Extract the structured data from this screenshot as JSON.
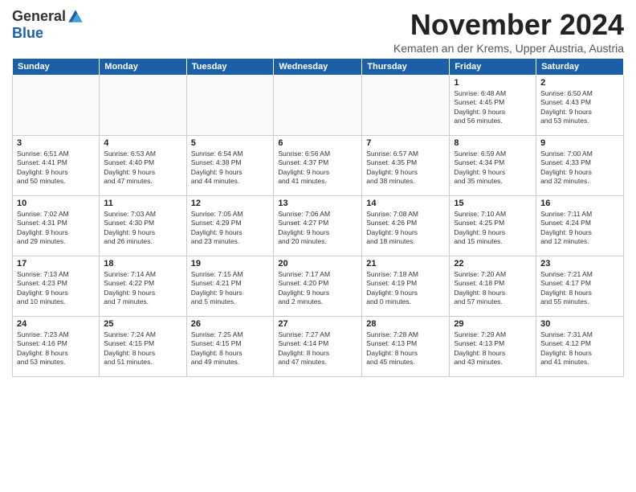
{
  "logo": {
    "general": "General",
    "blue": "Blue"
  },
  "title": "November 2024",
  "location": "Kematen an der Krems, Upper Austria, Austria",
  "headers": [
    "Sunday",
    "Monday",
    "Tuesday",
    "Wednesday",
    "Thursday",
    "Friday",
    "Saturday"
  ],
  "weeks": [
    [
      {
        "day": "",
        "info": ""
      },
      {
        "day": "",
        "info": ""
      },
      {
        "day": "",
        "info": ""
      },
      {
        "day": "",
        "info": ""
      },
      {
        "day": "",
        "info": ""
      },
      {
        "day": "1",
        "info": "Sunrise: 6:48 AM\nSunset: 4:45 PM\nDaylight: 9 hours\nand 56 minutes."
      },
      {
        "day": "2",
        "info": "Sunrise: 6:50 AM\nSunset: 4:43 PM\nDaylight: 9 hours\nand 53 minutes."
      }
    ],
    [
      {
        "day": "3",
        "info": "Sunrise: 6:51 AM\nSunset: 4:41 PM\nDaylight: 9 hours\nand 50 minutes."
      },
      {
        "day": "4",
        "info": "Sunrise: 6:53 AM\nSunset: 4:40 PM\nDaylight: 9 hours\nand 47 minutes."
      },
      {
        "day": "5",
        "info": "Sunrise: 6:54 AM\nSunset: 4:38 PM\nDaylight: 9 hours\nand 44 minutes."
      },
      {
        "day": "6",
        "info": "Sunrise: 6:56 AM\nSunset: 4:37 PM\nDaylight: 9 hours\nand 41 minutes."
      },
      {
        "day": "7",
        "info": "Sunrise: 6:57 AM\nSunset: 4:35 PM\nDaylight: 9 hours\nand 38 minutes."
      },
      {
        "day": "8",
        "info": "Sunrise: 6:59 AM\nSunset: 4:34 PM\nDaylight: 9 hours\nand 35 minutes."
      },
      {
        "day": "9",
        "info": "Sunrise: 7:00 AM\nSunset: 4:33 PM\nDaylight: 9 hours\nand 32 minutes."
      }
    ],
    [
      {
        "day": "10",
        "info": "Sunrise: 7:02 AM\nSunset: 4:31 PM\nDaylight: 9 hours\nand 29 minutes."
      },
      {
        "day": "11",
        "info": "Sunrise: 7:03 AM\nSunset: 4:30 PM\nDaylight: 9 hours\nand 26 minutes."
      },
      {
        "day": "12",
        "info": "Sunrise: 7:05 AM\nSunset: 4:29 PM\nDaylight: 9 hours\nand 23 minutes."
      },
      {
        "day": "13",
        "info": "Sunrise: 7:06 AM\nSunset: 4:27 PM\nDaylight: 9 hours\nand 20 minutes."
      },
      {
        "day": "14",
        "info": "Sunrise: 7:08 AM\nSunset: 4:26 PM\nDaylight: 9 hours\nand 18 minutes."
      },
      {
        "day": "15",
        "info": "Sunrise: 7:10 AM\nSunset: 4:25 PM\nDaylight: 9 hours\nand 15 minutes."
      },
      {
        "day": "16",
        "info": "Sunrise: 7:11 AM\nSunset: 4:24 PM\nDaylight: 9 hours\nand 12 minutes."
      }
    ],
    [
      {
        "day": "17",
        "info": "Sunrise: 7:13 AM\nSunset: 4:23 PM\nDaylight: 9 hours\nand 10 minutes."
      },
      {
        "day": "18",
        "info": "Sunrise: 7:14 AM\nSunset: 4:22 PM\nDaylight: 9 hours\nand 7 minutes."
      },
      {
        "day": "19",
        "info": "Sunrise: 7:15 AM\nSunset: 4:21 PM\nDaylight: 9 hours\nand 5 minutes."
      },
      {
        "day": "20",
        "info": "Sunrise: 7:17 AM\nSunset: 4:20 PM\nDaylight: 9 hours\nand 2 minutes."
      },
      {
        "day": "21",
        "info": "Sunrise: 7:18 AM\nSunset: 4:19 PM\nDaylight: 9 hours\nand 0 minutes."
      },
      {
        "day": "22",
        "info": "Sunrise: 7:20 AM\nSunset: 4:18 PM\nDaylight: 8 hours\nand 57 minutes."
      },
      {
        "day": "23",
        "info": "Sunrise: 7:21 AM\nSunset: 4:17 PM\nDaylight: 8 hours\nand 55 minutes."
      }
    ],
    [
      {
        "day": "24",
        "info": "Sunrise: 7:23 AM\nSunset: 4:16 PM\nDaylight: 8 hours\nand 53 minutes."
      },
      {
        "day": "25",
        "info": "Sunrise: 7:24 AM\nSunset: 4:15 PM\nDaylight: 8 hours\nand 51 minutes."
      },
      {
        "day": "26",
        "info": "Sunrise: 7:25 AM\nSunset: 4:15 PM\nDaylight: 8 hours\nand 49 minutes."
      },
      {
        "day": "27",
        "info": "Sunrise: 7:27 AM\nSunset: 4:14 PM\nDaylight: 8 hours\nand 47 minutes."
      },
      {
        "day": "28",
        "info": "Sunrise: 7:28 AM\nSunset: 4:13 PM\nDaylight: 8 hours\nand 45 minutes."
      },
      {
        "day": "29",
        "info": "Sunrise: 7:29 AM\nSunset: 4:13 PM\nDaylight: 8 hours\nand 43 minutes."
      },
      {
        "day": "30",
        "info": "Sunrise: 7:31 AM\nSunset: 4:12 PM\nDaylight: 8 hours\nand 41 minutes."
      }
    ]
  ]
}
